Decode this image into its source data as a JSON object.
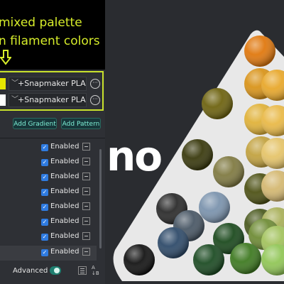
{
  "annotation": {
    "line1": " mixed palette",
    "line2": "n filament colors"
  },
  "filaments": [
    {
      "label": "+Snapmaker PLA ...",
      "swatch_color": "#e6e600"
    },
    {
      "label": "+Snapmaker PLA ...",
      "swatch_color": "#ffffff"
    }
  ],
  "buttons": {
    "add_gradient": "Add Gradient",
    "add_pattern": "Add Pattern"
  },
  "mixed_list": [
    {
      "label": "Enabled",
      "checked": true
    },
    {
      "label": "Enabled",
      "checked": true
    },
    {
      "label": "Enabled",
      "checked": true
    },
    {
      "label": "Enabled",
      "checked": true
    },
    {
      "label": "Enabled",
      "checked": true
    },
    {
      "label": "Enabled",
      "checked": true
    },
    {
      "label": "Enabled",
      "checked": true
    },
    {
      "label": "Enabled",
      "checked": true
    }
  ],
  "footer": {
    "advanced_label": "Advanced",
    "sort_icon": "A↓B"
  },
  "canvas": {
    "logo_text": "no",
    "tray_color": "#e8e8e8",
    "spheres": [
      {
        "color": "#e0780e"
      },
      {
        "color": "#d9941a"
      },
      {
        "color": "#e8a82c"
      },
      {
        "color": "#6e6310"
      },
      {
        "color": "#e0b23a"
      },
      {
        "color": "#e9b948"
      },
      {
        "color": "#3a3a0e"
      },
      {
        "color": "#c2a240"
      },
      {
        "color": "#e5c46a"
      },
      {
        "color": "#807a42"
      },
      {
        "color": "#4e5216"
      },
      {
        "color": "#d4b872"
      },
      {
        "color": "#2b2b2b"
      },
      {
        "color": "#7b93ad"
      },
      {
        "color": "#4b5a20"
      },
      {
        "color": "#a9b05a"
      },
      {
        "color": "#4a5866"
      },
      {
        "color": "#1c4a1e"
      },
      {
        "color": "#6f8c36"
      },
      {
        "color": "#a3c35e"
      },
      {
        "color": "#141414"
      },
      {
        "color": "#2f4b6a"
      },
      {
        "color": "#1d4c24"
      },
      {
        "color": "#3f7a22"
      },
      {
        "color": "#91c657"
      }
    ]
  }
}
